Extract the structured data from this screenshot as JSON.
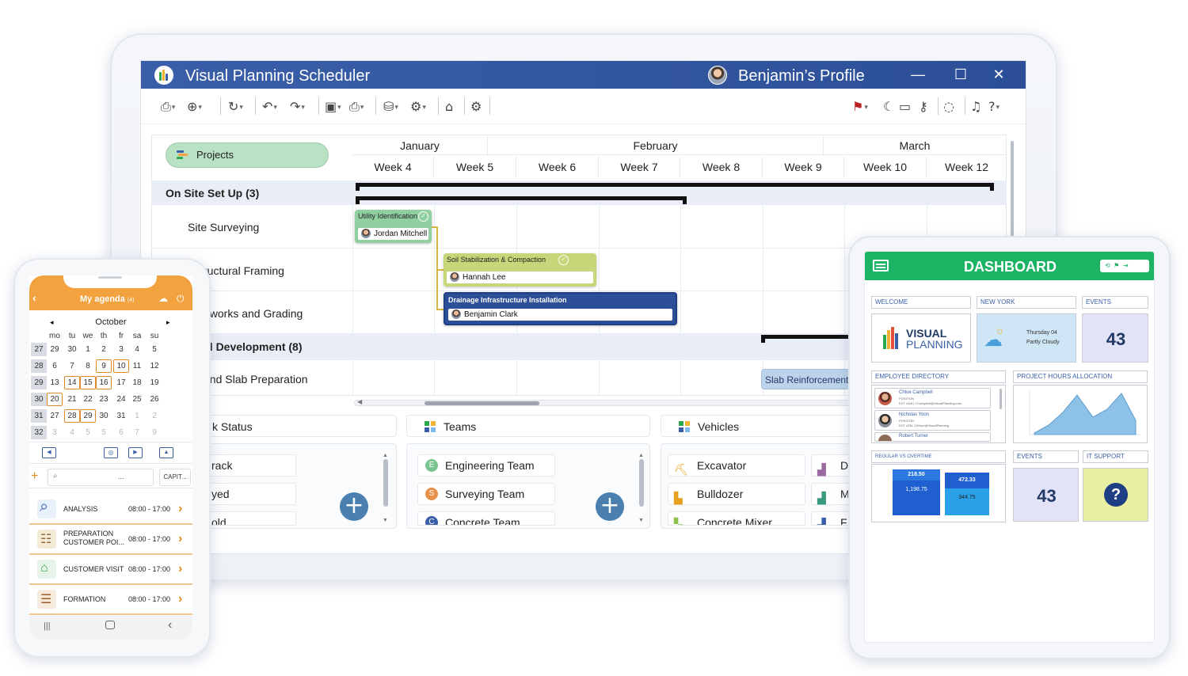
{
  "app": {
    "title": "Visual Planning Scheduler",
    "profile": "Benjamin’s Profile",
    "window_buttons": [
      "—",
      "☐",
      "✕"
    ],
    "brand_color": "#2c4f97"
  },
  "gantt": {
    "projects_button": "Projects",
    "months": [
      "January",
      "February",
      "March"
    ],
    "weeks": [
      "Week 4",
      "Week 5",
      "Week 6",
      "Week 7",
      "Week 8",
      "Week 9",
      "Week 10",
      "Week 12"
    ],
    "rows": [
      {
        "label": "On Site Set Up (3)",
        "type": "group"
      },
      {
        "label": "Site Surveying",
        "type": "task"
      },
      {
        "label": "ructural Framing",
        "type": "task"
      },
      {
        "label": "nworks and Grading",
        "type": "task"
      },
      {
        "label": "al Development (8)",
        "type": "group"
      },
      {
        "label": "and Slab Preparation",
        "type": "task"
      }
    ],
    "tasks": [
      {
        "title": "Utility Identification",
        "person": "Jordan Mitchell",
        "color": "#8fcfa0"
      },
      {
        "title": "Soil Stabilization & Compaction",
        "person": "Hannah Lee",
        "color": "#c6d77a"
      },
      {
        "title": "Drainage Infrastructure Installation",
        "person": "Benjamin Clark",
        "color": "#2c4f97"
      },
      {
        "title": "Slab Reinforcement",
        "color": "#bcd3ea"
      }
    ]
  },
  "panels": {
    "status": {
      "header": "k Status",
      "items": [
        "rack",
        "yed",
        "old"
      ]
    },
    "teams": {
      "header": "Teams",
      "items": [
        {
          "letter": "E",
          "label": "Engineering Team",
          "color": "#7ac48d"
        },
        {
          "letter": "S",
          "label": "Surveying Team",
          "color": "#e8914a"
        },
        {
          "letter": "C",
          "label": "Concrete Team",
          "color": "#3a5fa8"
        }
      ]
    },
    "vehicles": {
      "header": "Vehicles",
      "items": [
        "Excavator",
        "Bulldozer",
        "Concrete Mixer"
      ],
      "items_right": [
        "D",
        "M",
        "F"
      ]
    }
  },
  "phone": {
    "title": "My agenda",
    "title_badge": "(4)",
    "month": "October",
    "weekdays": [
      "mo",
      "tu",
      "we",
      "th",
      "fr",
      "sa",
      "su"
    ],
    "weeks": [
      {
        "num": "27",
        "days": [
          "29",
          "30",
          "1",
          "2",
          "3",
          "4",
          "5"
        ]
      },
      {
        "num": "28",
        "days": [
          "6",
          "7",
          "8",
          "9",
          "10",
          "11",
          "12"
        ]
      },
      {
        "num": "29",
        "days": [
          "13",
          "14",
          "15",
          "16",
          "17",
          "18",
          "19"
        ]
      },
      {
        "num": "30",
        "days": [
          "20",
          "21",
          "22",
          "23",
          "24",
          "25",
          "26"
        ]
      },
      {
        "num": "31",
        "days": [
          "27",
          "28",
          "29",
          "30",
          "31",
          "1",
          "2"
        ]
      },
      {
        "num": "32",
        "days": [
          "3",
          "4",
          "5",
          "5",
          "6",
          "7",
          "9"
        ]
      }
    ],
    "search_placeholder": "...",
    "capital_button": "CAPIT...",
    "agenda": [
      {
        "label": "ANALYSIS",
        "time": "08:00 - 17:00"
      },
      {
        "label": "PREPARATION CUSTOMER POI...",
        "time": "08:00 - 17:00"
      },
      {
        "label": "CUSTOMER VISIT",
        "time": "08:00 - 17:00"
      },
      {
        "label": "FORMATION",
        "time": "08:00 - 17:00"
      }
    ]
  },
  "dashboard": {
    "title": "DASHBOARD",
    "welcome": "WELCOME",
    "logo_top": "VISUAL",
    "logo_bottom": "PLANNING",
    "new_york": "NEW YORK",
    "weather_day": "Thursday 04",
    "weather_text": "Partly Cloudy",
    "events_label": "EVENTS",
    "events_value": "43",
    "employee_directory": "EMPLOYEE DIRECTORY",
    "employees": [
      {
        "name": "Chloe Campbell",
        "pos": "POSITION",
        "ext": "EXT x118 | CCampbell@VisualPlanning.com"
      },
      {
        "name": "Nicholas Yoon",
        "pos": "POSITION",
        "ext": "EXT x234 | NYoon@VisualPlanning"
      },
      {
        "name": "Robert Turner",
        "pos": "",
        "ext": ""
      }
    ],
    "project_hours": "PROJECT HOURS ALLOCATION",
    "regular_vs_overtime": "REGULAR VS OVERTIME",
    "bar_values": [
      "218.50",
      "1,198.75",
      "472.33",
      "344.75"
    ],
    "events2_label": "EVENTS",
    "events2_value": "43",
    "it_support": "IT SUPPORT",
    "it_icon": "?"
  }
}
